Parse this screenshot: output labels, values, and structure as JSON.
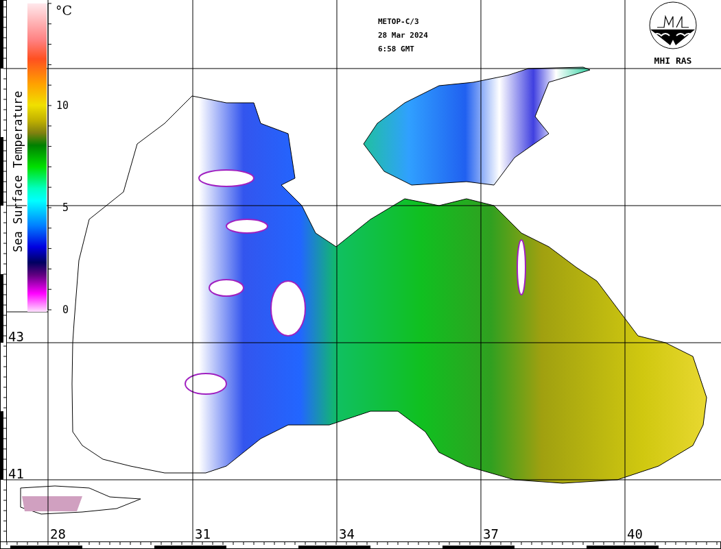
{
  "header": {
    "lines": [
      "METOP-C/3",
      "28 Mar 2024",
      "6:58 GMT"
    ]
  },
  "logo": {
    "label": "MHI RAS"
  },
  "colorbar": {
    "title": "Sea Surface Temperature",
    "unit": "°C",
    "ticks": [
      "10",
      "5",
      "0"
    ]
  },
  "latitude_labels": [
    "43",
    "41"
  ],
  "longitude_labels": [
    "28",
    "31",
    "34",
    "37",
    "40"
  ]
}
